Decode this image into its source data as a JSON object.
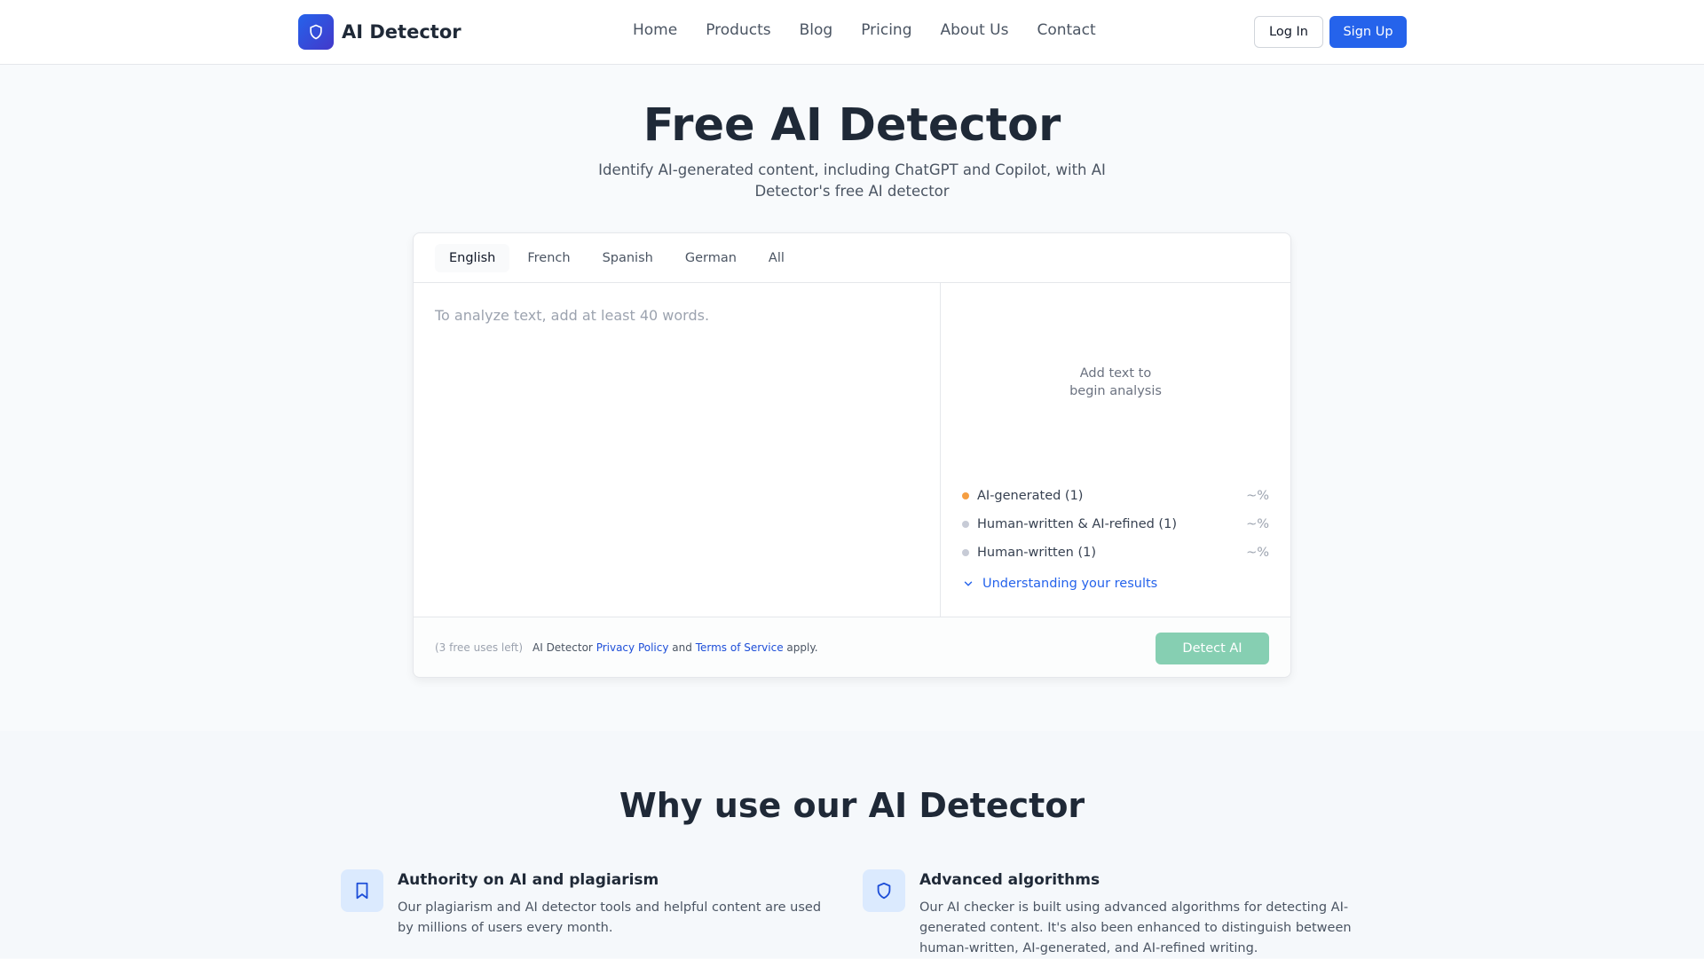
{
  "header": {
    "logo_text": "AI Detector",
    "nav": [
      "Home",
      "Products",
      "Blog",
      "Pricing",
      "About Us",
      "Contact"
    ],
    "login": "Log In",
    "signup": "Sign Up"
  },
  "hero": {
    "title": "Free AI Detector",
    "subtitle": "Identify AI-generated content, including ChatGPT and Copilot, with AI Detector's free AI detector"
  },
  "tool": {
    "tabs": [
      "English",
      "French",
      "Spanish",
      "German",
      "All"
    ],
    "active_tab": "English",
    "editor_value": "",
    "editor_placeholder": "To analyze text, add at least 40 words.",
    "empty_line1": "Add text to",
    "empty_line2": "begin analysis",
    "legend": [
      {
        "label": "AI-generated (1)",
        "pct": "~%",
        "color": "#f59e42"
      },
      {
        "label": "Human-written & AI-refined (1)",
        "pct": "~%",
        "color": "#c7cbd6"
      },
      {
        "label": "Human-written (1)",
        "pct": "~%",
        "color": "#c7cbd6"
      }
    ],
    "understanding_link": "Understanding your results",
    "uses_left": "(3 free uses left)",
    "terms_prefix": "AI Detector",
    "privacy_link": "Privacy Policy",
    "terms_and": "and",
    "terms_link": "Terms of Service",
    "terms_suffix": "apply.",
    "detect_button": "Detect AI"
  },
  "why": {
    "title": "Why use our AI Detector",
    "features": [
      {
        "icon": "bookmark-icon",
        "title": "Authority on AI and plagiarism",
        "desc": "Our plagiarism and AI detector tools and helpful content are used by millions of users every month."
      },
      {
        "icon": "shield-icon",
        "title": "Advanced algorithms",
        "desc": "Our AI checker is built using advanced algorithms for detecting AI-generated content. It's also been enhanced to distinguish between human-written, AI-generated, and AI-refined writing."
      }
    ]
  },
  "colors": {
    "brand": "#2563eb",
    "detect_button": "#86cfb2",
    "ai_dot": "#f59e42",
    "human_dot": "#c7cbd6"
  }
}
